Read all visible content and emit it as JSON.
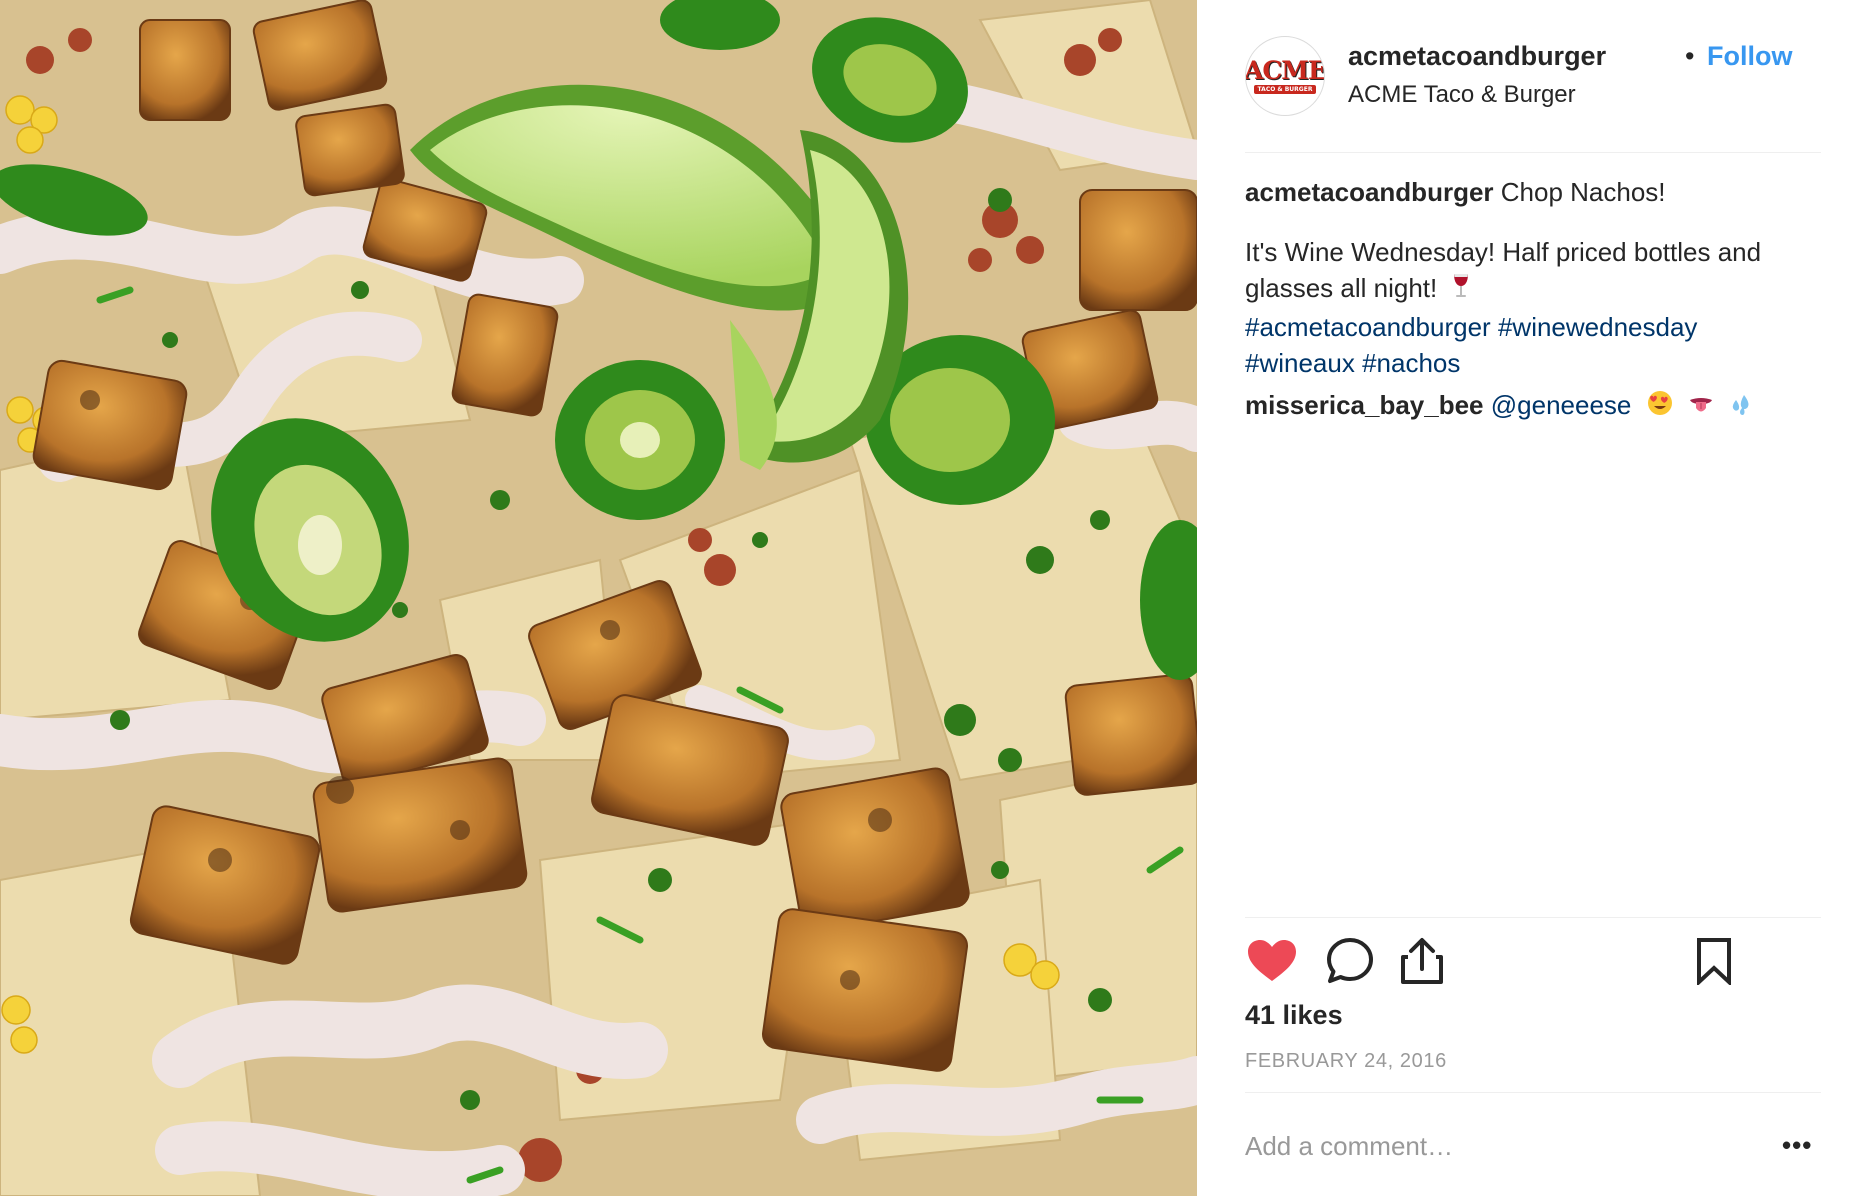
{
  "post": {
    "photo": {
      "subject": "chop-nachos-photo",
      "colors": {
        "chip": "#e8d6a6",
        "chicken": "#c7852f",
        "crema": "#efe4e2",
        "jalapeno": "#2f8a1c",
        "lime": "#b9dd72"
      }
    },
    "header": {
      "username": "acmetacoandburger",
      "separator": "•",
      "follow_label": "Follow",
      "location": "ACME Taco & Burger",
      "avatar_logo_text": "ACME",
      "avatar_logo_subtext": "TACO & BURGER"
    },
    "caption": {
      "username": "acmetacoandburger",
      "line1": "Chop Nachos!",
      "line2": "It's Wine Wednesday! Half priced bottles and glasses all night!",
      "emoji": "wine-glass-emoji",
      "hashtags": [
        "#acmetacoandburger",
        "#winewednesday",
        "#wineaux",
        "#nachos"
      ]
    },
    "reply": {
      "username": "misserica_bay_bee",
      "mention": "@geneeese",
      "emojis": [
        "heart-eyes-emoji",
        "tongue-emoji",
        "sweat-droplets-emoji"
      ]
    },
    "actions": {
      "like_icon": "heart-icon",
      "comment_icon": "comment-icon",
      "share_icon": "share-icon",
      "save_icon": "bookmark-icon",
      "liked": true,
      "like_color": "#ed4956"
    },
    "likes": "41 likes",
    "date": "FEBRUARY 24, 2016",
    "comment_placeholder": "Add a comment…",
    "more_label": "•••"
  }
}
